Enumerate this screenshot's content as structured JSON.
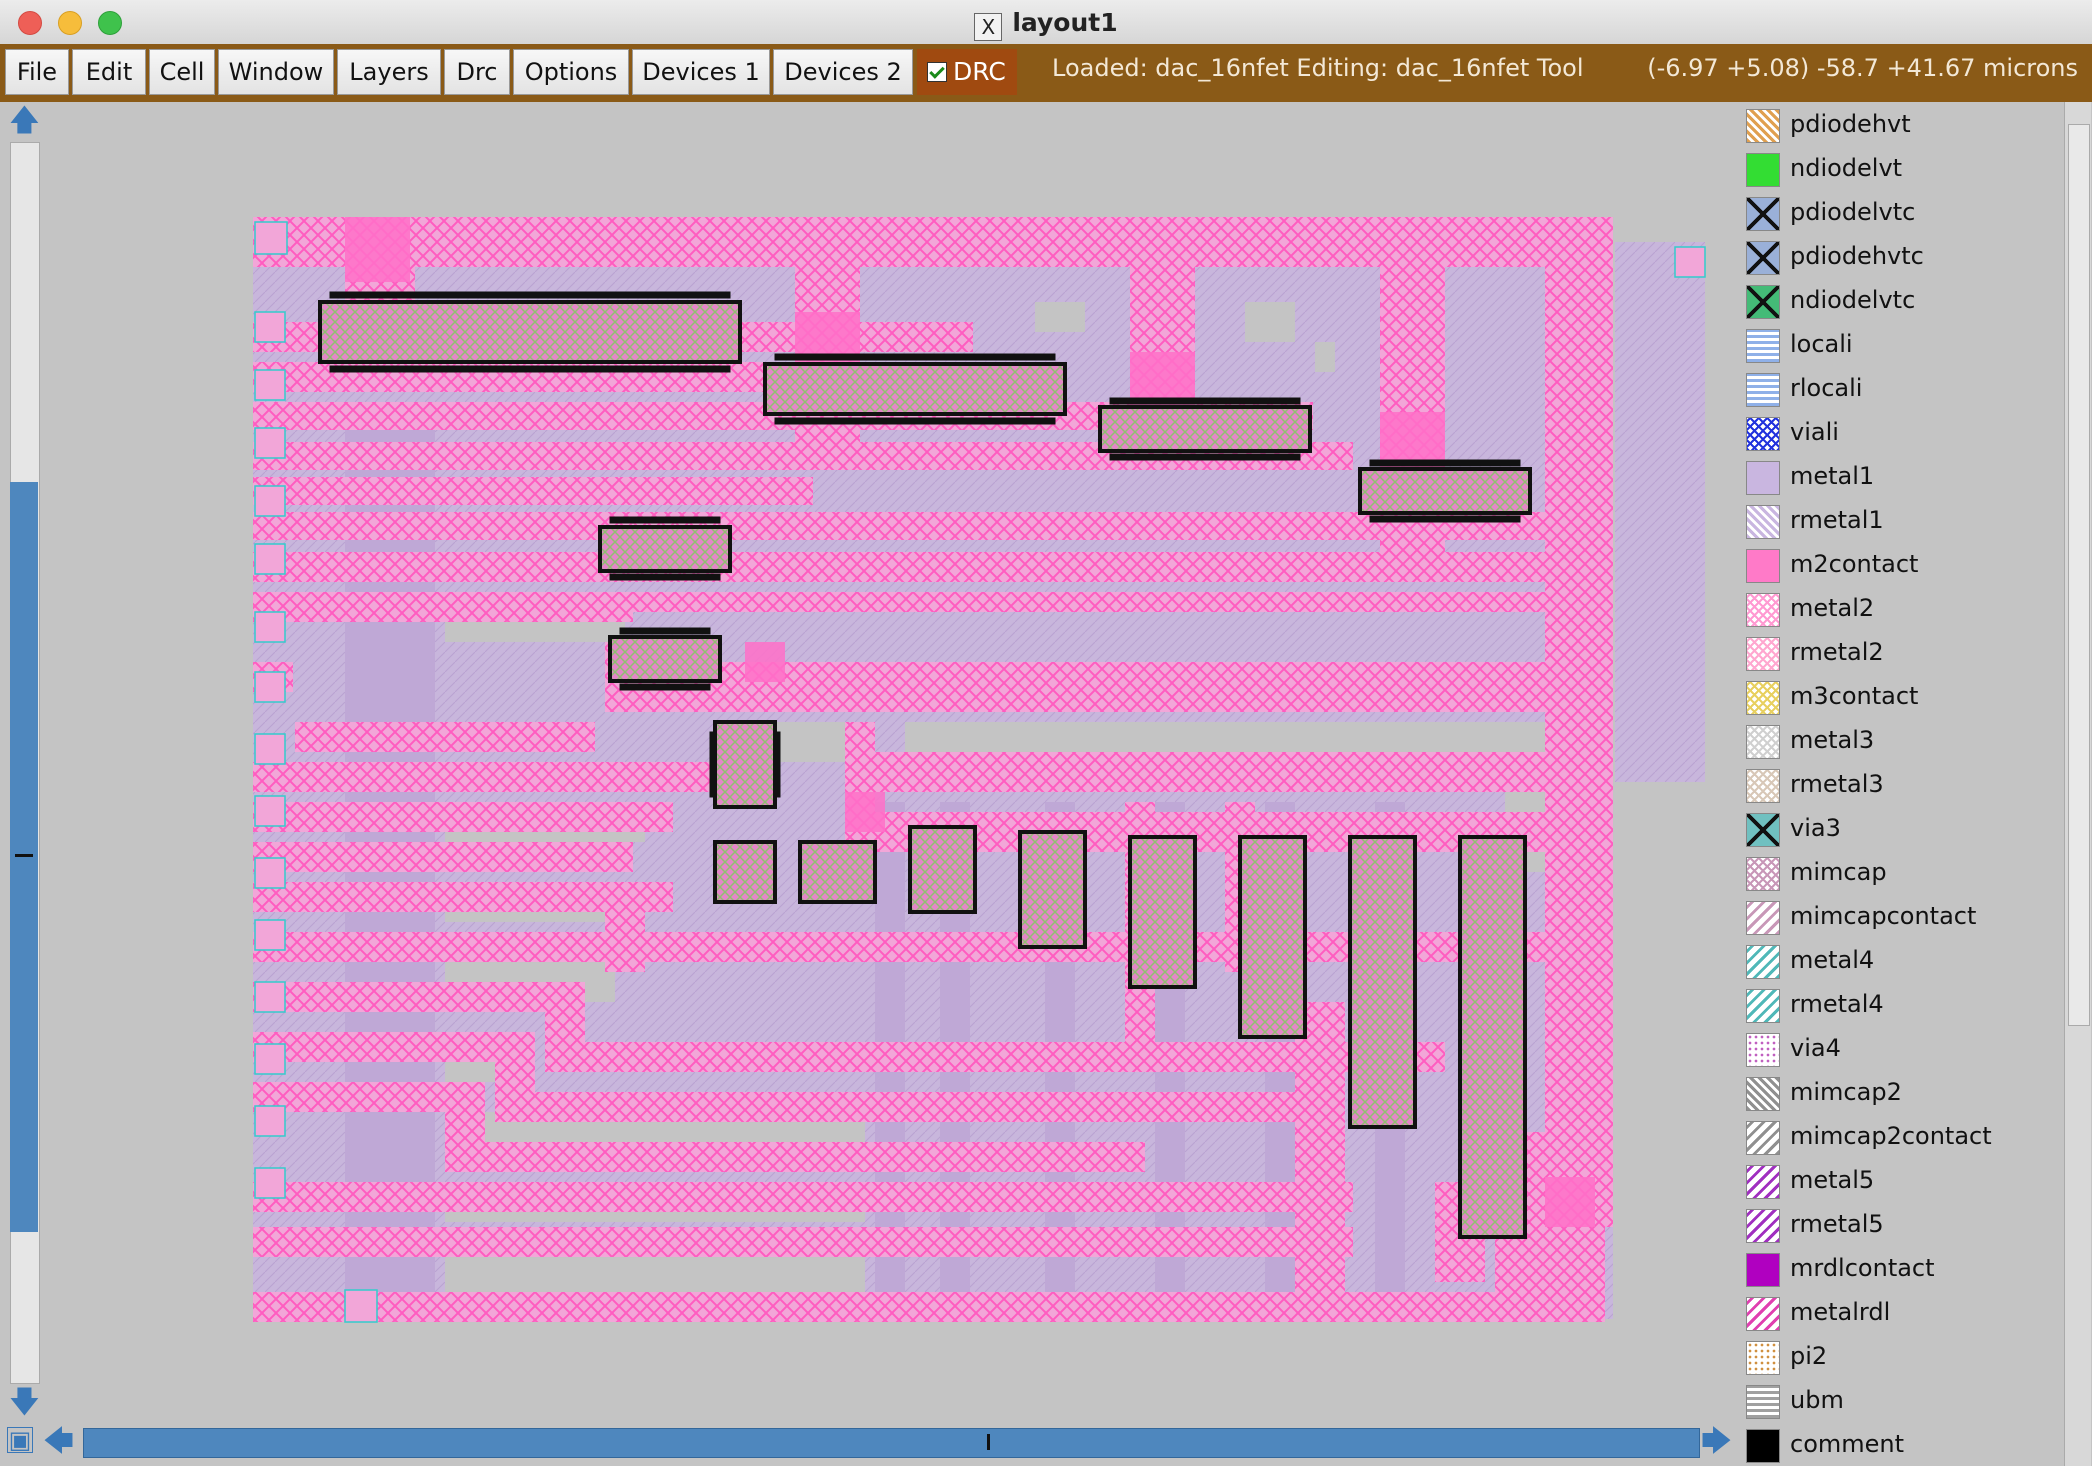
{
  "window": {
    "title": "layout1"
  },
  "menu": [
    "File",
    "Edit",
    "Cell",
    "Window",
    "Layers",
    "Drc",
    "Options",
    "Devices 1",
    "Devices 2"
  ],
  "drc_toggle": {
    "label": "DRC",
    "checked": true
  },
  "status": {
    "loaded": "Loaded: dac_16nfet Editing: dac_16nfet Tool",
    "coordinates": "(-6.97 +5.08) -58.7 +41.67 microns"
  },
  "layers": [
    {
      "name": "pdiodehvt",
      "color": "#e0a050",
      "pattern": "hatch"
    },
    {
      "name": "ndiodelvt",
      "color": "#33dd33",
      "pattern": "solid"
    },
    {
      "name": "pdiodelvtc",
      "color": "#9ab0d8",
      "pattern": "box-x"
    },
    {
      "name": "pdiodehvtc",
      "color": "#9ab0d8",
      "pattern": "box-x"
    },
    {
      "name": "ndiodelvtc",
      "color": "#44bb77",
      "pattern": "box-x"
    },
    {
      "name": "locali",
      "color": "#8fb0e8",
      "pattern": "wave"
    },
    {
      "name": "rlocali",
      "color": "#8fb0e8",
      "pattern": "wave"
    },
    {
      "name": "viali",
      "color": "#2233dd",
      "pattern": "cross"
    },
    {
      "name": "metal1",
      "color": "#c9b6e0",
      "pattern": "solid"
    },
    {
      "name": "rmetal1",
      "color": "#c9b6e0",
      "pattern": "hatch"
    },
    {
      "name": "m2contact",
      "color": "#ff7ac8",
      "pattern": "solid"
    },
    {
      "name": "metal2",
      "color": "#ff9ad2",
      "pattern": "cross"
    },
    {
      "name": "rmetal2",
      "color": "#ffa8d0",
      "pattern": "cross"
    },
    {
      "name": "m3contact",
      "color": "#e8d060",
      "pattern": "cross"
    },
    {
      "name": "metal3",
      "color": "#d0d0d0",
      "pattern": "cross"
    },
    {
      "name": "rmetal3",
      "color": "#d8c8b8",
      "pattern": "cross"
    },
    {
      "name": "via3",
      "color": "#70c0c0",
      "pattern": "box-x"
    },
    {
      "name": "mimcap",
      "color": "#c898b8",
      "pattern": "cross"
    },
    {
      "name": "mimcapcontact",
      "color": "#c898b8",
      "pattern": "slash"
    },
    {
      "name": "metal4",
      "color": "#50b8b8",
      "pattern": "slash"
    },
    {
      "name": "rmetal4",
      "color": "#50b8b8",
      "pattern": "slash"
    },
    {
      "name": "via4",
      "color": "#c060c0",
      "pattern": "dots"
    },
    {
      "name": "mimcap2",
      "color": "#909090",
      "pattern": "hatch"
    },
    {
      "name": "mimcap2contact",
      "color": "#909090",
      "pattern": "slash"
    },
    {
      "name": "metal5",
      "color": "#a030c0",
      "pattern": "slash"
    },
    {
      "name": "rmetal5",
      "color": "#a030c0",
      "pattern": "slash"
    },
    {
      "name": "mrdlcontact",
      "color": "#b000c0",
      "pattern": "solid"
    },
    {
      "name": "metalrdl",
      "color": "#e040b0",
      "pattern": "slash"
    },
    {
      "name": "pi2",
      "color": "#d09040",
      "pattern": "dots"
    },
    {
      "name": "ubm",
      "color": "#a0a0a0",
      "pattern": "wave"
    },
    {
      "name": "comment",
      "color": "#000000",
      "pattern": "solid"
    }
  ]
}
